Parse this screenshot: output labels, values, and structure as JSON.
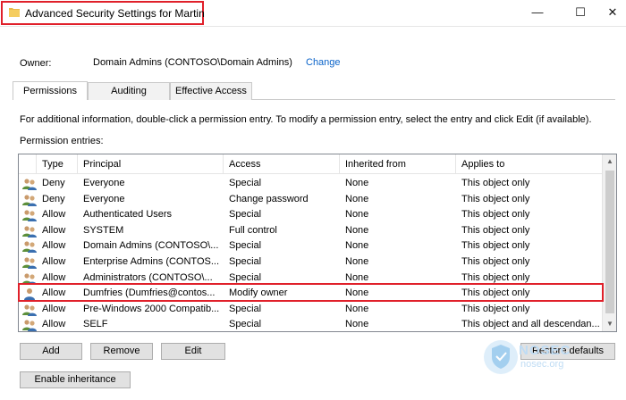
{
  "window": {
    "title": "Advanced Security Settings for Martin",
    "controls": {
      "minimize": "—",
      "maximize": "☐",
      "close": "✕"
    }
  },
  "owner": {
    "label": "Owner:",
    "value": "Domain Admins (CONTOSO\\Domain Admins)",
    "change_link": "Change"
  },
  "tabs": [
    {
      "label": "Permissions",
      "active": true
    },
    {
      "label": "Auditing",
      "active": false
    },
    {
      "label": "Effective Access",
      "active": false
    }
  ],
  "info_text": "For additional information, double-click a permission entry. To modify a permission entry, select the entry and click Edit (if available).",
  "entries_label": "Permission entries:",
  "table": {
    "columns": [
      "Type",
      "Principal",
      "Access",
      "Inherited from",
      "Applies to"
    ],
    "rows": [
      {
        "type": "Deny",
        "principal": "Everyone",
        "access": "Special",
        "inherited": "None",
        "applies": "This object only",
        "icon": "group-icon"
      },
      {
        "type": "Deny",
        "principal": "Everyone",
        "access": "Change password",
        "inherited": "None",
        "applies": "This object only",
        "icon": "group-icon"
      },
      {
        "type": "Allow",
        "principal": "Authenticated Users",
        "access": "Special",
        "inherited": "None",
        "applies": "This object only",
        "icon": "group-icon"
      },
      {
        "type": "Allow",
        "principal": "SYSTEM",
        "access": "Full control",
        "inherited": "None",
        "applies": "This object only",
        "icon": "group-icon"
      },
      {
        "type": "Allow",
        "principal": "Domain Admins (CONTOSO\\...",
        "access": "Special",
        "inherited": "None",
        "applies": "This object only",
        "icon": "group-icon"
      },
      {
        "type": "Allow",
        "principal": "Enterprise Admins (CONTOS...",
        "access": "Special",
        "inherited": "None",
        "applies": "This object only",
        "icon": "group-icon"
      },
      {
        "type": "Allow",
        "principal": "Administrators (CONTOSO\\...",
        "access": "Special",
        "inherited": "None",
        "applies": "This object only",
        "icon": "group-icon"
      },
      {
        "type": "Allow",
        "principal": "Dumfries (Dumfries@contos...",
        "access": "Modify owner",
        "inherited": "None",
        "applies": "This object only",
        "icon": "user-icon"
      },
      {
        "type": "Allow",
        "principal": "Pre-Windows 2000 Compatib...",
        "access": "Special",
        "inherited": "None",
        "applies": "This object only",
        "icon": "group-icon"
      },
      {
        "type": "Allow",
        "principal": "SELF",
        "access": "Special",
        "inherited": "None",
        "applies": "This object and all descendan...",
        "icon": "group-icon"
      }
    ]
  },
  "buttons": {
    "add": "Add",
    "remove": "Remove",
    "edit": "Edit",
    "restore_defaults": "Restore defaults",
    "enable_inheritance": "Enable inheritance"
  },
  "watermark": {
    "brand": "NOSEC",
    "site": "nosec.org"
  },
  "colors": {
    "highlight": "#e0202a",
    "link": "#0a63c9",
    "button_bg": "#e1e1e1"
  }
}
